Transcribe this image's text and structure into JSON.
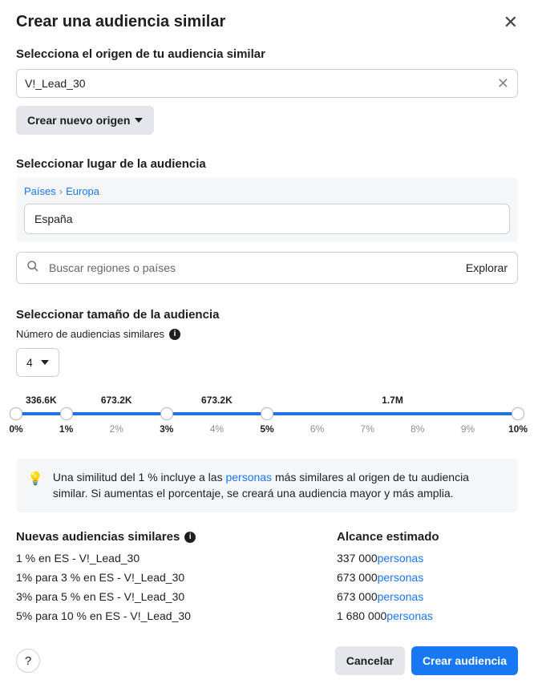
{
  "dialog": {
    "title": "Crear una audiencia similar"
  },
  "source": {
    "label": "Selecciona el origen de tu audiencia similar",
    "value": "V!_Lead_30",
    "create_label": "Crear nuevo origen"
  },
  "location": {
    "label": "Seleccionar lugar de la audiencia",
    "breadcrumb": {
      "level1": "Países",
      "level2": "Europa"
    },
    "selected": "España",
    "search_placeholder": "Buscar regiones o países",
    "explore_label": "Explorar"
  },
  "size": {
    "label": "Seleccionar tamaño de la audiencia",
    "count_label": "Número de audiencias similares",
    "count_value": "4",
    "range_values": [
      {
        "pos": 5,
        "text": "336.6K"
      },
      {
        "pos": 20,
        "text": "673.2K"
      },
      {
        "pos": 40,
        "text": "673.2K"
      },
      {
        "pos": 75,
        "text": "1.7M"
      }
    ],
    "handles_pct": [
      0,
      10,
      30,
      50,
      100
    ],
    "ticks": [
      {
        "pct": 0,
        "label": "0%",
        "active": true
      },
      {
        "pct": 10,
        "label": "1%",
        "active": true
      },
      {
        "pct": 20,
        "label": "2%",
        "active": false
      },
      {
        "pct": 30,
        "label": "3%",
        "active": true
      },
      {
        "pct": 40,
        "label": "4%",
        "active": false
      },
      {
        "pct": 50,
        "label": "5%",
        "active": true
      },
      {
        "pct": 60,
        "label": "6%",
        "active": false
      },
      {
        "pct": 70,
        "label": "7%",
        "active": false
      },
      {
        "pct": 80,
        "label": "8%",
        "active": false
      },
      {
        "pct": 90,
        "label": "9%",
        "active": false
      },
      {
        "pct": 100,
        "label": "10%",
        "active": true
      }
    ]
  },
  "tip": {
    "pre": "Una similitud del 1 % incluye a las ",
    "link": "personas",
    "post": " más similares al origen de tu audiencia similar. Si aumentas el porcentaje, se creará una audiencia mayor y más amplia."
  },
  "results": {
    "audiences_header": "Nuevas audiencias similares",
    "reach_header": "Alcance estimado",
    "rows": [
      {
        "name": "1 % en ES - V!_Lead_30",
        "reach_num": "337 000",
        "reach_unit": "personas"
      },
      {
        "name": "1% para 3 % en ES - V!_Lead_30",
        "reach_num": "673 000",
        "reach_unit": "personas"
      },
      {
        "name": "3% para 5 % en ES - V!_Lead_30",
        "reach_num": "673 000",
        "reach_unit": "personas"
      },
      {
        "name": "5% para 10 % en ES - V!_Lead_30",
        "reach_num": "1 680 000",
        "reach_unit": "personas"
      }
    ]
  },
  "footer": {
    "cancel": "Cancelar",
    "create": "Crear audiencia"
  }
}
